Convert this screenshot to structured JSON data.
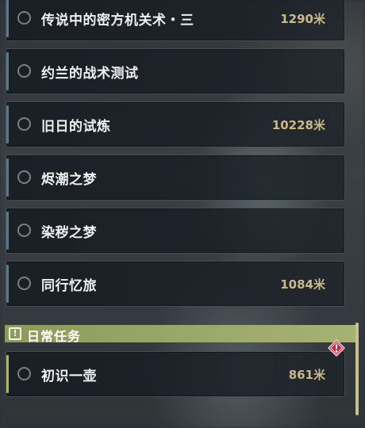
{
  "quests": [
    {
      "title": "传说中的密方机关术・三",
      "distance": "1290米"
    },
    {
      "title": "约兰的战术测试",
      "distance": ""
    },
    {
      "title": "旧日的试炼",
      "distance": "10228米"
    },
    {
      "title": "烬潮之梦",
      "distance": ""
    },
    {
      "title": "染秽之梦",
      "distance": ""
    },
    {
      "title": "同行忆旅",
      "distance": "1084米"
    }
  ],
  "daily_section": {
    "title": "日常任务",
    "quests": [
      {
        "title": "初识一壶",
        "distance": "861米"
      }
    ]
  },
  "colors": {
    "daily_accent": "#9aa868",
    "distance_text": "#c9b98a",
    "warning_badge": "#c0334a"
  },
  "icons": {
    "daily_header": "exclamation-box-icon",
    "quest_status": "empty-circle-icon",
    "daily_warning": "red-diamond-exclamation-icon"
  }
}
